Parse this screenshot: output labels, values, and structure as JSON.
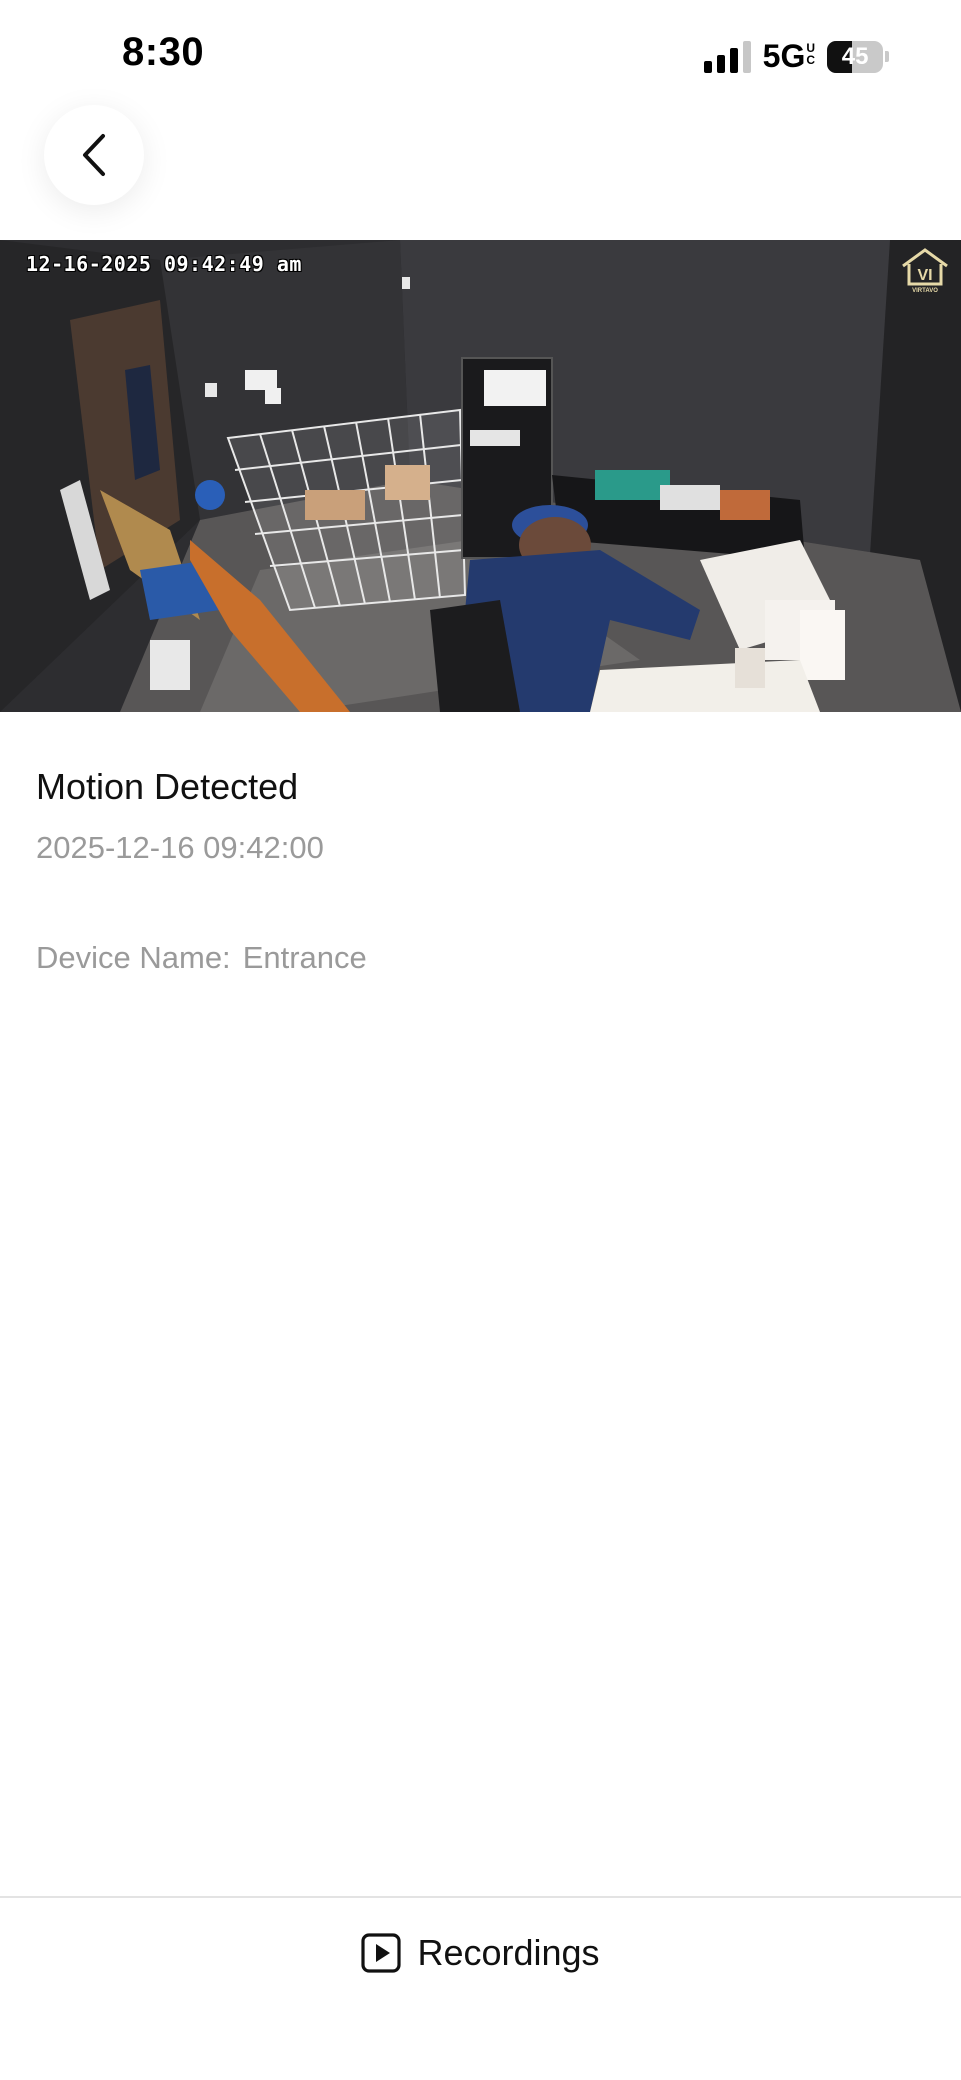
{
  "status_bar": {
    "time": "8:30",
    "network": "5G",
    "network_badge": "UC",
    "battery": "45",
    "battery_level": 0.45
  },
  "nav": {
    "back_icon": "chevron-left-icon"
  },
  "video": {
    "timestamp": "12-16-2025 09:42:49 am",
    "logo_text": "VIRTAVO"
  },
  "event": {
    "title": "Motion Detected",
    "datetime": "2025-12-16 09:42:00",
    "device_label": "Device Name:",
    "device_name": "Entrance"
  },
  "footer": {
    "recordings_icon": "play-square-icon",
    "recordings_label": "Recordings"
  }
}
